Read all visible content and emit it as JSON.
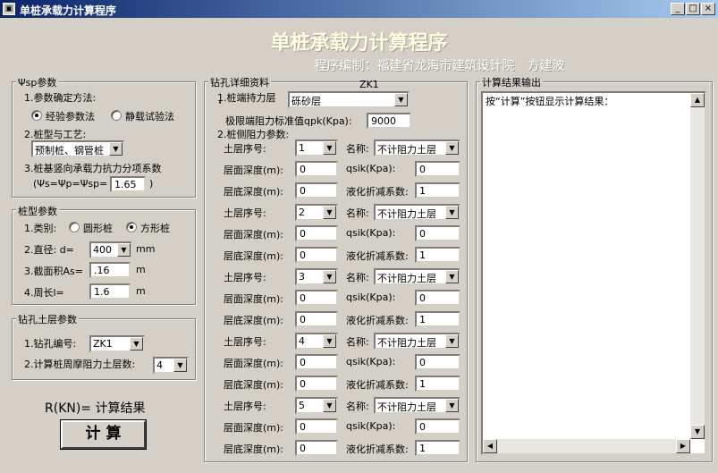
{
  "window": {
    "title": "单桩承载力计算程序",
    "title_icon": "app-icon",
    "controls": [
      "_",
      "□",
      "×"
    ]
  },
  "header": {
    "title": "单桩承载力计算程序",
    "subtitle": "程序编制：福建省龙海市建筑设计院　方建波"
  },
  "psi": {
    "legend": "Ψsp参数",
    "method_label": "1.参数确定方法:",
    "radio_empirical": "经验参数法",
    "radio_static": "静载试验法",
    "pile_type_label": "2.桩型与工艺:",
    "pile_type_value": "预制桩、钢管桩",
    "coef_label": "3.桩基竖向承载力抗力分项系数",
    "coef_prefix": "(Ψs=Ψp=Ψsp=",
    "coef_value": "1.65",
    "coef_suffix": ")"
  },
  "pile": {
    "legend": "桩型参数",
    "category_label": "1.类别:",
    "radio_round": "圆形桩",
    "radio_square": "方形桩",
    "diameter_label": "2.直径: d=",
    "diameter_value": "400",
    "diameter_unit": "mm",
    "area_label": "3.截面积As=",
    "area_value": ".16",
    "area_unit": "m",
    "perimeter_label": "4.周长l=",
    "perimeter_value": "1.6",
    "perimeter_unit": "m"
  },
  "soil": {
    "legend": "钻孔土层参数",
    "hole_label": "1.钻孔编号:",
    "hole_value": "ZK1",
    "layers_label": "2.计算桩周摩阻力土层数:",
    "layers_value": "4"
  },
  "result": {
    "label": "R(KN)= 计算结果",
    "button": "计 算"
  },
  "borehole": {
    "legend": "钻孔详细资料",
    "hole_id": "ZK1",
    "bearing_label": "1.桩端持力层",
    "bearing_value": "砾砂层",
    "qpk_label": "极限端阻力标准值qpk(Kpa):",
    "qpk_value": "9000",
    "side_label": "2.桩侧阻力参数:",
    "seq_label": "土层序号:",
    "top_label": "层面深度(m):",
    "bottom_label": "层底深度(m):",
    "name_label": "名称:",
    "qsik_label": "qsik(Kpa):",
    "liq_label": "液化折减系数:",
    "layers": [
      {
        "seq": "1",
        "name": "不计阻力土层",
        "top": "0",
        "bottom": "0",
        "qsik": "0",
        "liq": "1"
      },
      {
        "seq": "2",
        "name": "不计阻力土层",
        "top": "0",
        "bottom": "0",
        "qsik": "0",
        "liq": "1"
      },
      {
        "seq": "3",
        "name": "不计阻力土层",
        "top": "0",
        "bottom": "0",
        "qsik": "0",
        "liq": "1"
      },
      {
        "seq": "4",
        "name": "不计阻力土层",
        "top": "0",
        "bottom": "0",
        "qsik": "0",
        "liq": "1"
      },
      {
        "seq": "5",
        "name": "不计阻力土层",
        "top": "0",
        "bottom": "0",
        "qsik": "0",
        "liq": "1"
      }
    ]
  },
  "output": {
    "legend": "计算结果输出",
    "text": "按“计算”按钮显示计算结果："
  }
}
